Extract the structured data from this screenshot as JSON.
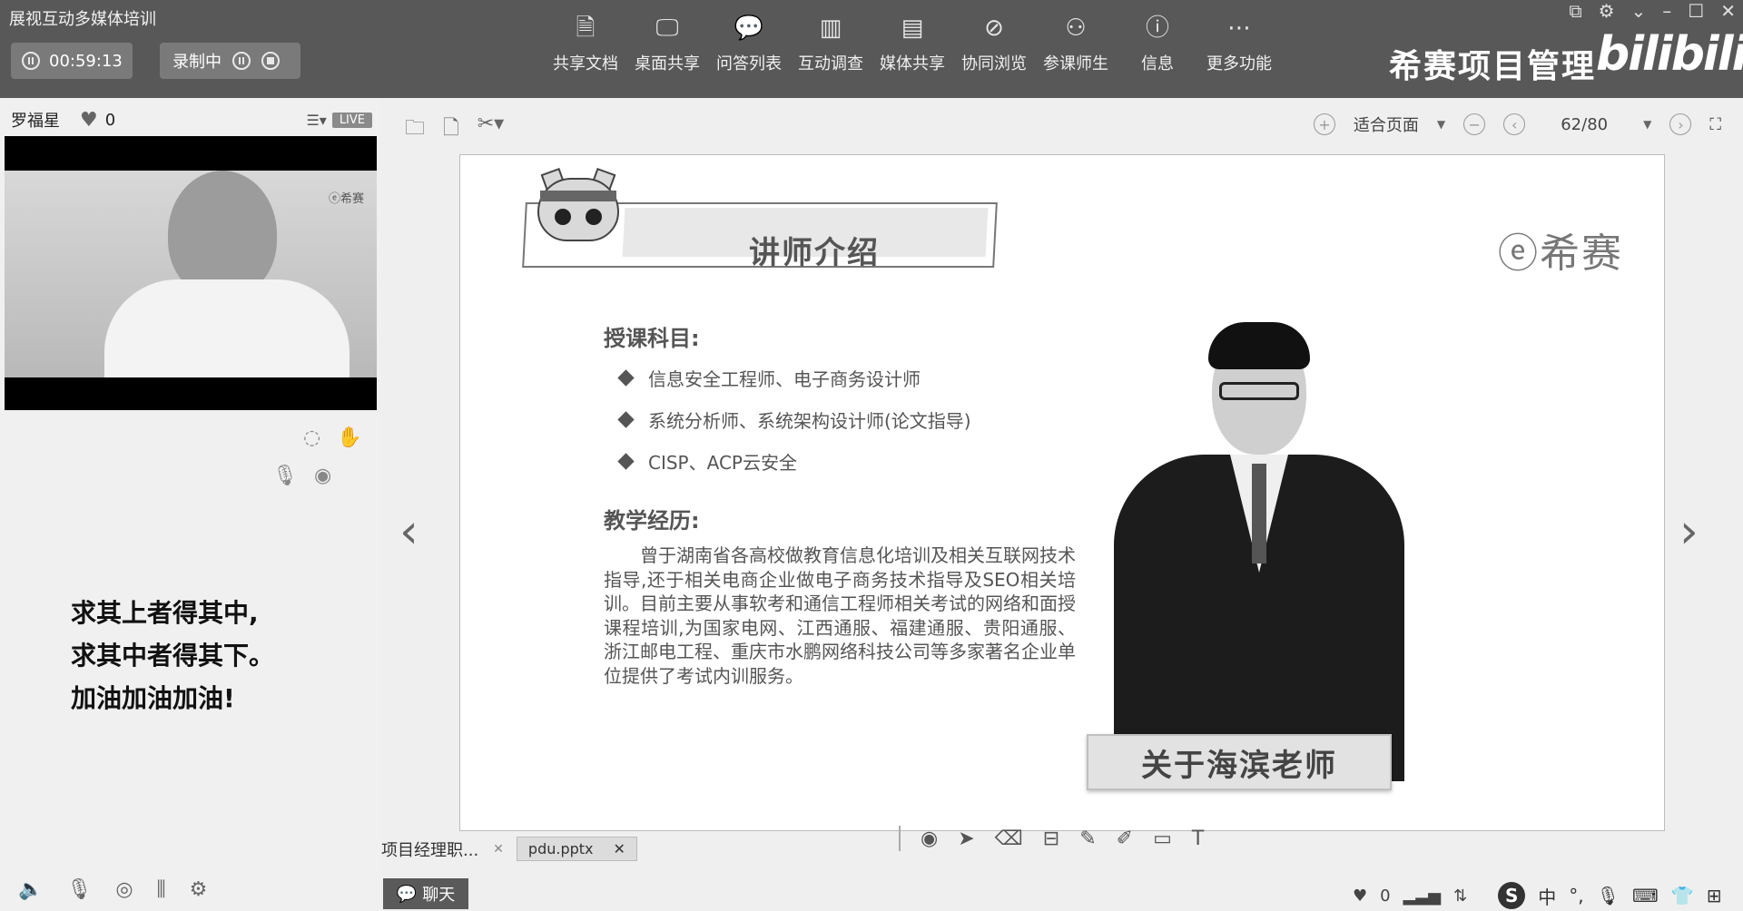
{
  "app": {
    "title": "展视互动多媒体培训"
  },
  "session": {
    "elapsed": "00:59:13",
    "recording_label": "录制中"
  },
  "toolbar": {
    "items": [
      {
        "label": "共享文档",
        "icon": "document-icon"
      },
      {
        "label": "桌面共享",
        "icon": "desktop-share-icon"
      },
      {
        "label": "问答列表",
        "icon": "qa-bubble-icon"
      },
      {
        "label": "互动调查",
        "icon": "bar-chart-icon"
      },
      {
        "label": "媒体共享",
        "icon": "film-icon"
      },
      {
        "label": "协同浏览",
        "icon": "compass-icon"
      },
      {
        "label": "参课师生",
        "icon": "users-icon"
      },
      {
        "label": "信息",
        "icon": "info-icon"
      },
      {
        "label": "更多功能",
        "icon": "more-dots-icon"
      }
    ]
  },
  "brand": {
    "text": "希赛项目管理",
    "logo_text": "bilibili"
  },
  "presenter": {
    "name": "罗福星",
    "likes": "0",
    "live_badge": "LIVE",
    "video_watermark": "ⓔ希赛"
  },
  "motto": {
    "line1": "求其上者得其中,",
    "line2": "求其中者得其下。",
    "line3": "加油加油加油!"
  },
  "document": {
    "zoom_label": "适合页面",
    "page_indicator": "62/80"
  },
  "slide": {
    "section_title": "讲师介绍",
    "logo_text": "ⓔ希赛",
    "subjects_heading": "授课科目:",
    "subjects": [
      "信息安全工程师、电子商务设计师",
      "系统分析师、系统架构设计师(论文指导)",
      "CISP、ACP云安全"
    ],
    "experience_heading": "教学经历:",
    "experience_text": "曾于湖南省各高校做教育信息化培训及相关互联网技术指导,还于相关电商企业做电子商务技术指导及SEO相关培训。目前主要从事软考和通信工程师相关考试的网络和面授课程培训,为国家电网、江西通服、福建通服、贵阳通服、浙江邮电工程、重庆市水鹏网络科技公司等多家著名企业单位提供了考试内训服务。",
    "name_card": "关于海滨老师"
  },
  "tabs": {
    "project_tab": "项目经理职...",
    "file_tab": "pdu.pptx"
  },
  "bottom": {
    "chat_label": "聊天",
    "likes": "0",
    "ime_label": "中"
  }
}
